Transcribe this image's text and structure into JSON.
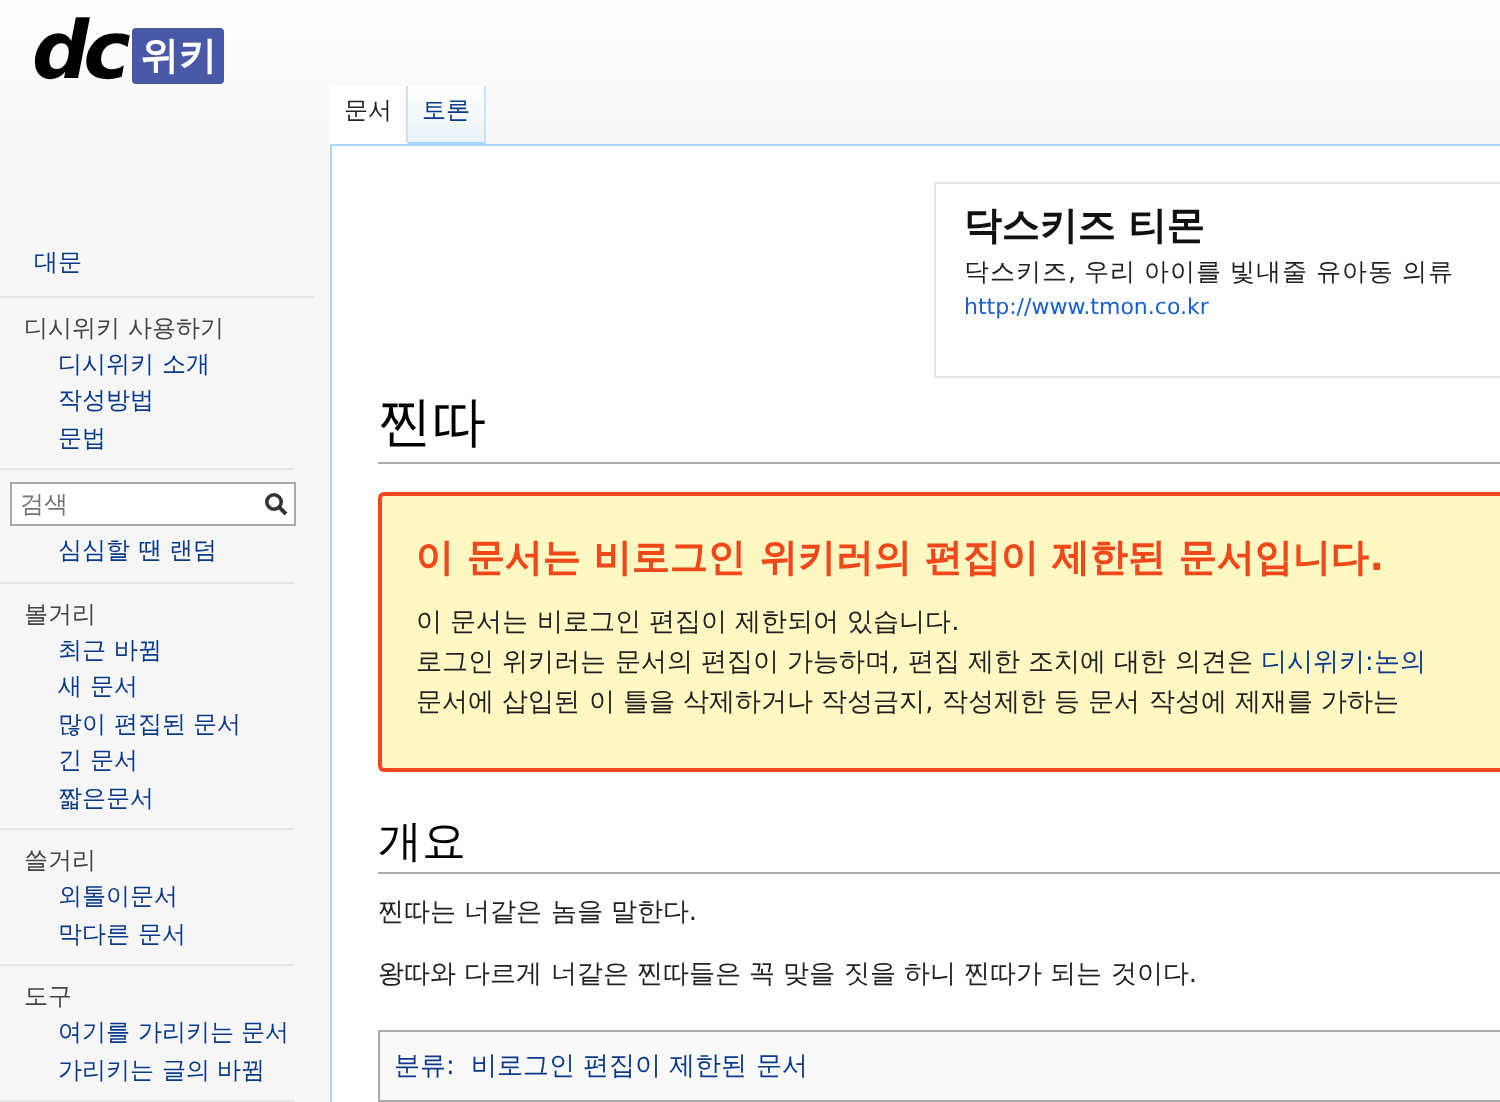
{
  "logo": {
    "mark": "dc",
    "badge": "위키"
  },
  "tabs": [
    {
      "label": "문서",
      "selected": true
    },
    {
      "label": "토론",
      "selected": false
    }
  ],
  "sidebar": {
    "home": "대문",
    "usage": {
      "heading": "디시위키 사용하기",
      "items": [
        "디시위키 소개",
        "작성방법",
        "문법"
      ]
    },
    "search": {
      "placeholder": "검색"
    },
    "random": "심심할 땐 랜덤",
    "sections": [
      {
        "heading": "볼거리",
        "items": [
          "최근 바뀜",
          "새 문서",
          "많이 편집된 문서",
          "긴 문서",
          "짧은문서"
        ]
      },
      {
        "heading": "쓸거리",
        "items": [
          "외톨이문서",
          "막다른 문서"
        ]
      },
      {
        "heading": "도구",
        "items": [
          "여기를 가리키는 문서",
          "가리키는 글의 바뀜"
        ]
      }
    ]
  },
  "ad": {
    "title": "닥스키즈 티몬",
    "description": "닥스키즈, 우리 아이를 빛내줄 유아동 의류",
    "url": "http://www.tmon.co.kr"
  },
  "article": {
    "title": "찐따",
    "notice": {
      "heading": "이 문서는 비로그인 위키러의 편집이 제한된 문서입니다.",
      "lines": [
        {
          "text": "이 문서는 비로그인 편집이 제한되어 있습니다."
        },
        {
          "text": "로그인 위키러는 문서의 편집이 가능하며, 편집 제한 조치에 대한 의견은",
          "link": "디시위키:논의"
        },
        {
          "text": "문서에 삽입된 이 틀을 삭제하거나 작성금지, 작성제한 등 문서 작성에 제재를 가하는"
        }
      ]
    },
    "sections": [
      {
        "heading": "개요",
        "paragraphs": [
          "찐따는 너같은 놈을 말한다.",
          "왕따와 다르게 너같은 찐따들은 꼭 맞을 짓을 하니 찐따가 되는 것이다."
        ]
      }
    ],
    "categories": {
      "label": "분류:",
      "items": [
        "비로그인 편집이 제한된 문서"
      ]
    }
  }
}
